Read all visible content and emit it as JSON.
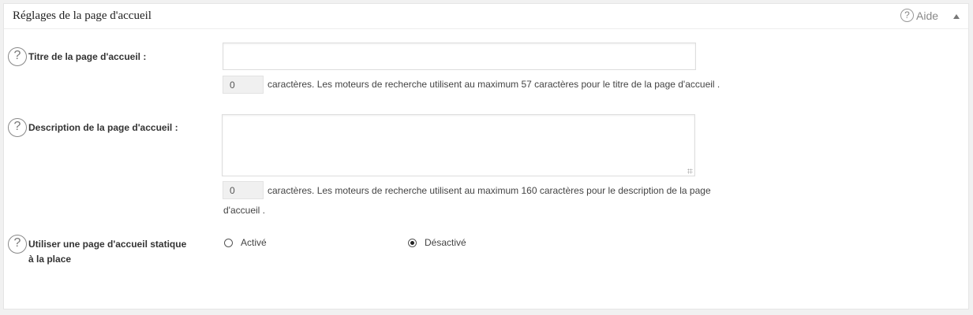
{
  "panel": {
    "title": "Réglages de la page d'accueil",
    "help_label": "Aide",
    "help_icon": "question-circle-icon",
    "collapse_icon": "triangle-up-icon"
  },
  "fields": {
    "home_title": {
      "label": "Titre de la page d'accueil :",
      "value": "",
      "char_count": "0",
      "hint": "caractères. Les moteurs de recherche utilisent au maximum 57 caractères pour le titre de la page d'accueil ."
    },
    "home_description": {
      "label": "Description de la page d'accueil :",
      "value": "",
      "char_count": "0",
      "hint_line1": "caractères. Les moteurs de recherche utilisent au maximum 160 caractères pour le description de la page",
      "hint_line2": "d'accueil ."
    },
    "static_home": {
      "label_line1": "Utiliser une page d'accueil statique",
      "label_line2": "à la place",
      "options": [
        {
          "label": "Activé",
          "checked": false
        },
        {
          "label": "Désactivé",
          "checked": true
        }
      ]
    }
  },
  "colors": {
    "background": "#f1f1f1",
    "panel": "#ffffff",
    "text": "#444444"
  }
}
